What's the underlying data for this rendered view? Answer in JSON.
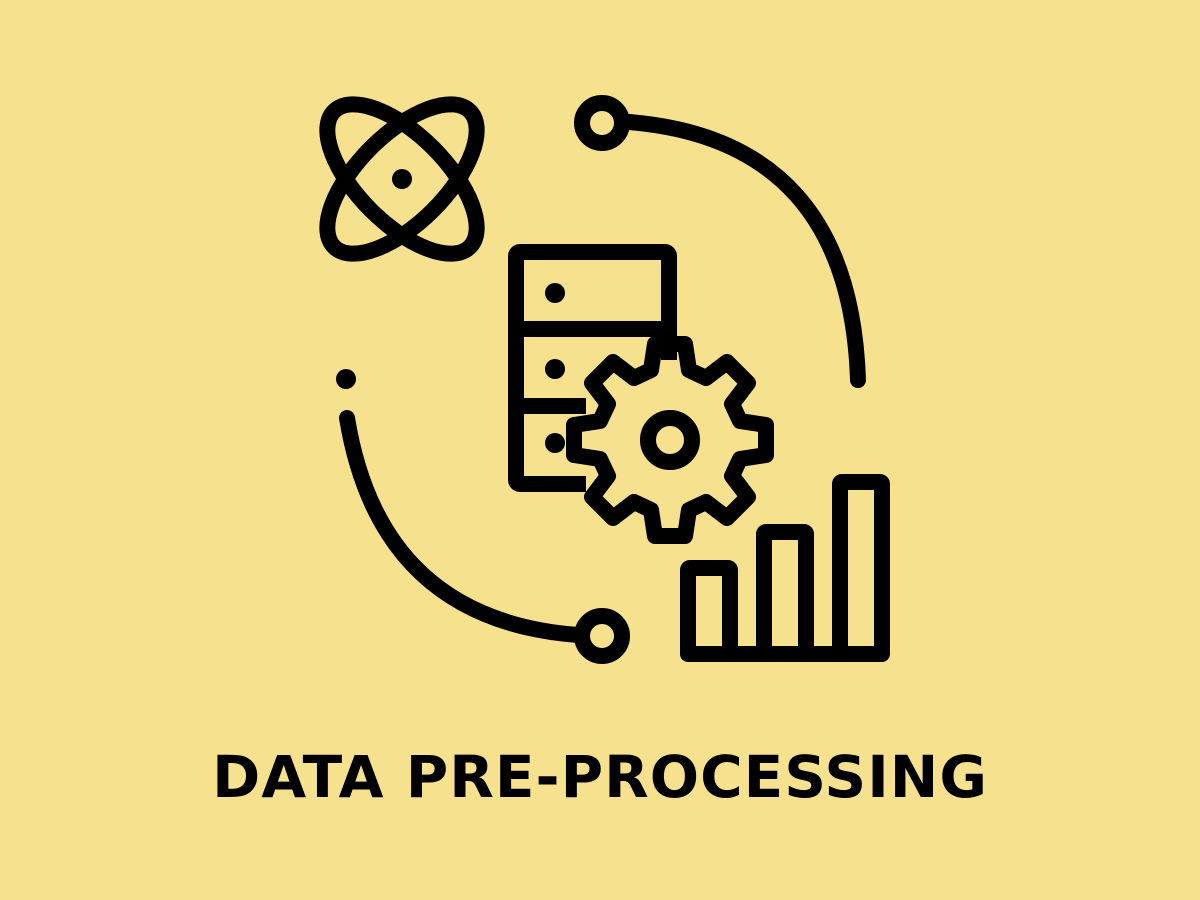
{
  "caption": "DATA PRE-PROCESSING",
  "colors": {
    "background": "#f6e28e",
    "ink": "#000000"
  },
  "icons": [
    "atom-icon",
    "server-icon",
    "gear-icon",
    "bar-chart-icon",
    "cycle-arrows-icon"
  ]
}
